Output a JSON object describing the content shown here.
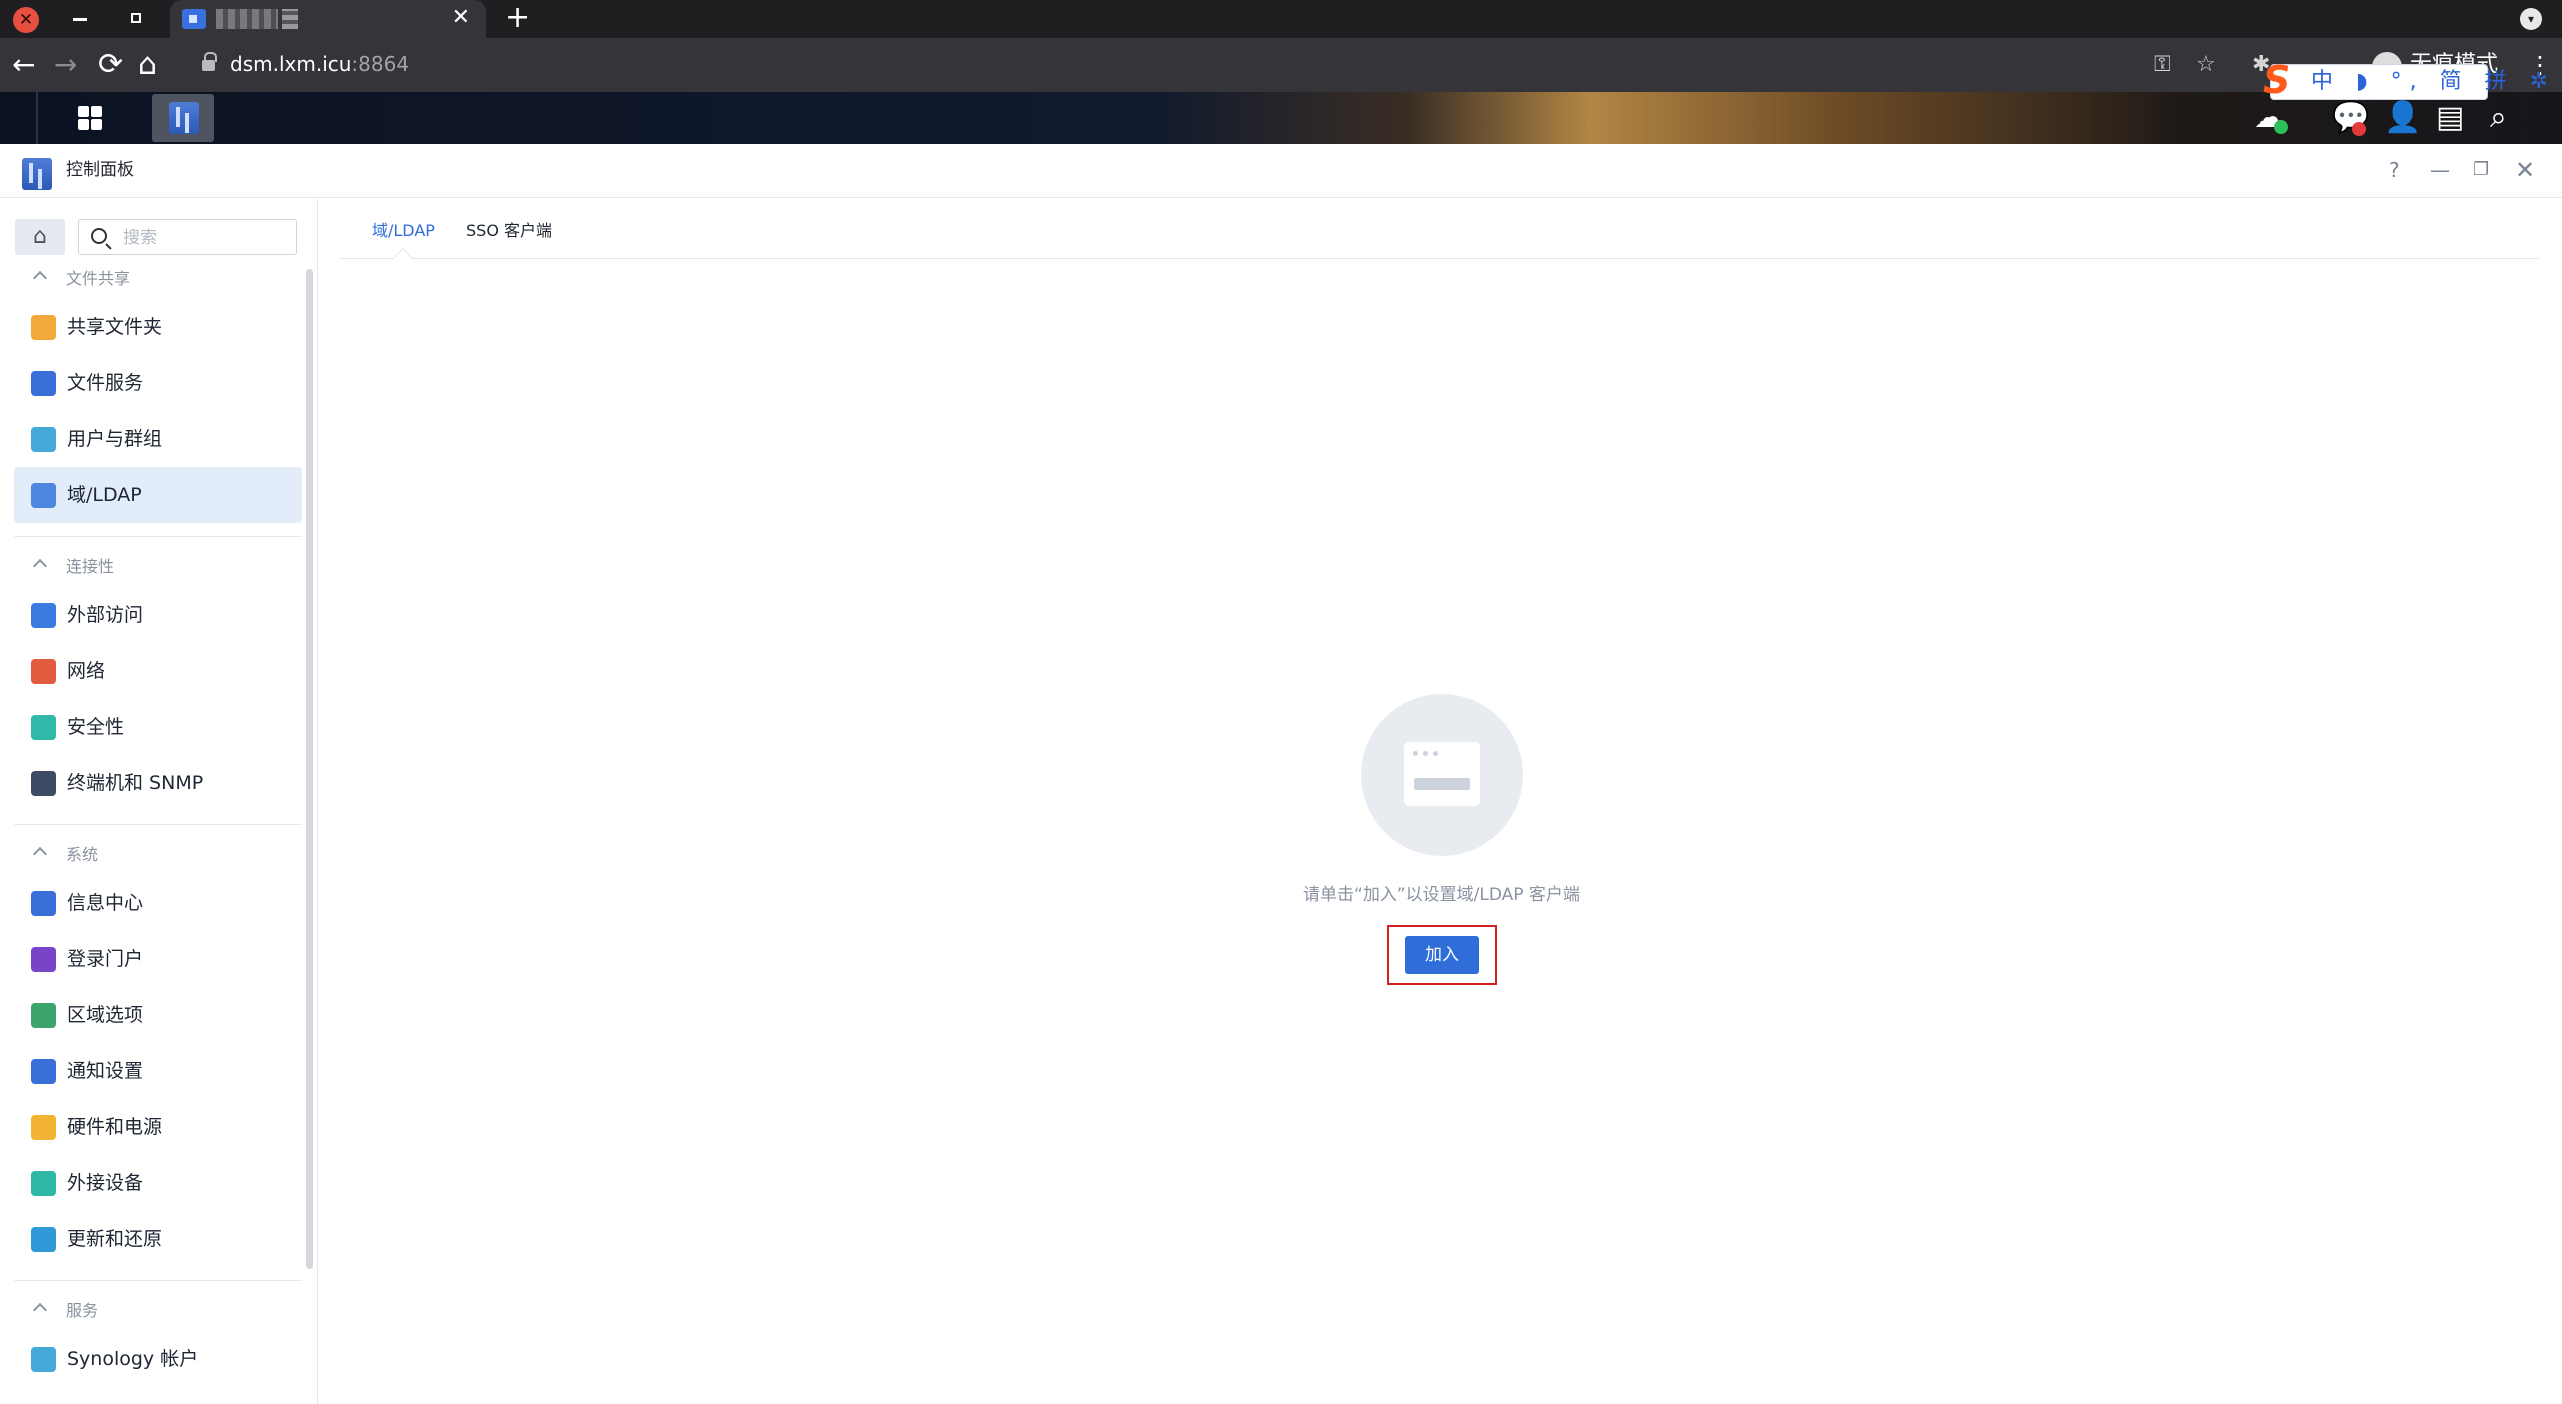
{
  "browser": {
    "url_host": "dsm.lxm.icu",
    "url_port": ":8864",
    "incognito_label": "无痕模式",
    "new_tab": "+",
    "tab_close": "✕",
    "menu": "⋮",
    "ime_items": "中 ◗ °, 简 拼 ✲"
  },
  "icons": {
    "back": "←",
    "forward": "→",
    "reload": "⟳",
    "home": "⌂",
    "key": "⚿",
    "star": "☆",
    "puzzle": "✱",
    "chat": "💬",
    "user": "👤",
    "widget": "▤",
    "search": "⌕",
    "cloud": "☁"
  },
  "window": {
    "title": "控制面板",
    "controls": {
      "help": "?",
      "minimize": "—",
      "restore": "❐",
      "close": "✕"
    }
  },
  "sidebar": {
    "home_glyph": "⌂",
    "search_placeholder": "搜索",
    "groups": [
      {
        "label": "文件共享",
        "items": [
          {
            "label": "共享文件夹",
            "icon": "folder-share-icon",
            "color": "#f3a83b"
          },
          {
            "label": "文件服务",
            "icon": "file-services-icon",
            "color": "#3a6fd8"
          },
          {
            "label": "用户与群组",
            "icon": "users-groups-icon",
            "color": "#46a8d9"
          },
          {
            "label": "域/LDAP",
            "icon": "domain-ldap-icon",
            "color": "#4c86e0",
            "active": true
          }
        ]
      },
      {
        "label": "连接性",
        "items": [
          {
            "label": "外部访问",
            "icon": "external-access-icon",
            "color": "#3a7be0"
          },
          {
            "label": "网络",
            "icon": "network-icon",
            "color": "#e25b3c"
          },
          {
            "label": "安全性",
            "icon": "security-icon",
            "color": "#30b8a8"
          },
          {
            "label": "终端机和 SNMP",
            "icon": "terminal-icon",
            "color": "#3d4a63"
          }
        ]
      },
      {
        "label": "系统",
        "items": [
          {
            "label": "信息中心",
            "icon": "info-center-icon",
            "color": "#3a6fd8"
          },
          {
            "label": "登录门户",
            "icon": "login-portal-icon",
            "color": "#7a44c8"
          },
          {
            "label": "区域选项",
            "icon": "regional-options-icon",
            "color": "#3aa46a"
          },
          {
            "label": "通知设置",
            "icon": "notification-icon",
            "color": "#3a6fd8"
          },
          {
            "label": "硬件和电源",
            "icon": "hardware-power-icon",
            "color": "#f2b232"
          },
          {
            "label": "外接设备",
            "icon": "external-devices-icon",
            "color": "#2fb7a6"
          },
          {
            "label": "更新和还原",
            "icon": "update-restore-icon",
            "color": "#2f9ad8"
          }
        ]
      },
      {
        "label": "服务",
        "items": [
          {
            "label": "Synology 帐户",
            "icon": "synology-account-icon",
            "color": "#46a8d9"
          }
        ]
      }
    ]
  },
  "main": {
    "tabs": [
      {
        "label": "域/LDAP",
        "active": true
      },
      {
        "label": "SSO 客户端",
        "active": false
      }
    ],
    "empty_message": "请单击“加入”以设置域/LDAP 客户端",
    "join_button": "加入"
  },
  "colors": {
    "accent": "#2f6ed8",
    "active_bg": "#e3edf9",
    "highlight_outline": "#d62020"
  }
}
